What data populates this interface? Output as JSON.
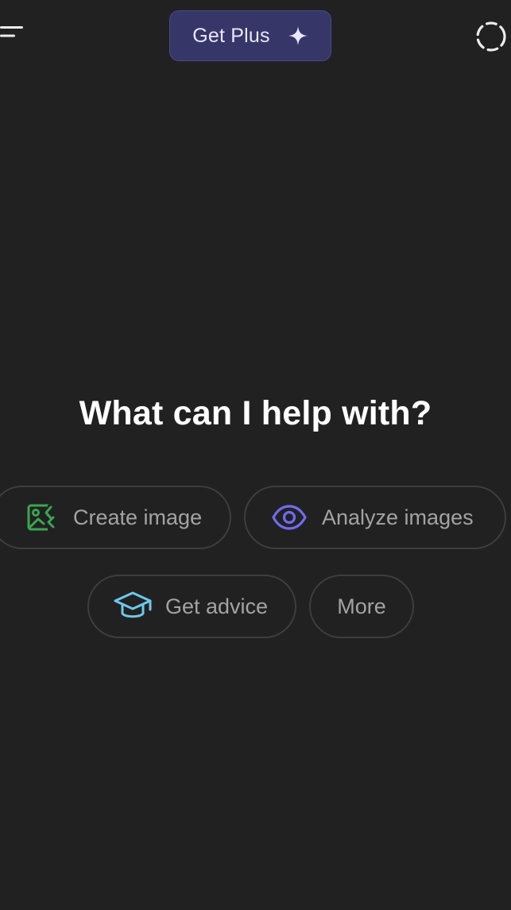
{
  "header": {
    "get_plus_label": "Get Plus",
    "menu_icon": "hamburger-menu-icon",
    "sparkle_icon": "sparkle-icon",
    "temporary_chat_icon": "dashed-circle-icon",
    "get_plus_bg": "#373669"
  },
  "main": {
    "headline": "What can I help with?"
  },
  "suggestions": [
    {
      "label": "Create image",
      "icon": "image-create-icon",
      "icon_color": "#3aa651"
    },
    {
      "label": "Analyze images",
      "icon": "eye-icon",
      "icon_color": "#6f6cf0"
    },
    {
      "label": "Get advice",
      "icon": "graduation-cap-icon",
      "icon_color": "#6fc7ea"
    },
    {
      "label": "More",
      "icon": "",
      "icon_color": ""
    }
  ],
  "colors": {
    "background": "#212121",
    "chip_border": "#3e3e3e",
    "chip_text": "#a3a3a3"
  }
}
